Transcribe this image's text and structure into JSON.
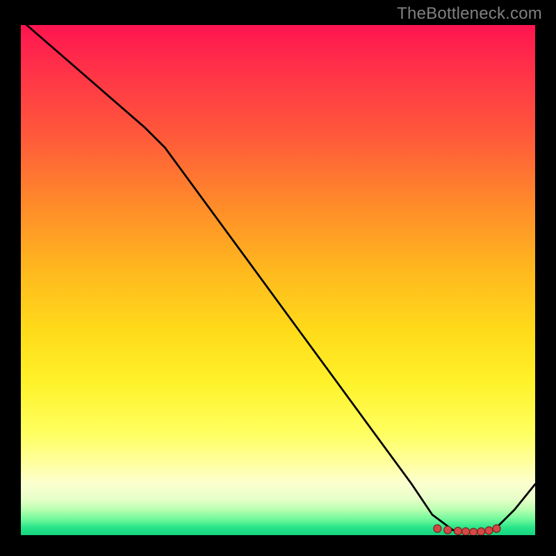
{
  "watermark": "TheBottleneck.com",
  "chart_data": {
    "type": "line",
    "title": "",
    "xlabel": "",
    "ylabel": "",
    "xlim": [
      0,
      100
    ],
    "ylim": [
      0,
      100
    ],
    "grid": false,
    "legend": false,
    "series": [
      {
        "name": "bottleneck-curve",
        "x": [
          0,
          8,
          16,
          24,
          28,
          36,
          44,
          52,
          60,
          68,
          76,
          80,
          84,
          88,
          92,
          96,
          100
        ],
        "y": [
          101,
          94,
          87,
          80,
          76,
          65,
          54,
          43,
          32,
          21,
          10,
          4,
          1,
          0.5,
          1,
          5,
          10
        ]
      }
    ],
    "highlighted_points": {
      "name": "optimal-range",
      "x": [
        81,
        83,
        85,
        86.5,
        88,
        89.5,
        91,
        92.5
      ],
      "y": [
        1.3,
        1.0,
        0.8,
        0.7,
        0.6,
        0.7,
        0.9,
        1.3
      ]
    },
    "gradient_stops": [
      {
        "pos": 0.0,
        "color": "#ff1450"
      },
      {
        "pos": 0.22,
        "color": "#ff5a3a"
      },
      {
        "pos": 0.48,
        "color": "#ffb81e"
      },
      {
        "pos": 0.7,
        "color": "#fff22a"
      },
      {
        "pos": 0.9,
        "color": "#fbffd0"
      },
      {
        "pos": 1.0,
        "color": "#14d47e"
      }
    ]
  }
}
